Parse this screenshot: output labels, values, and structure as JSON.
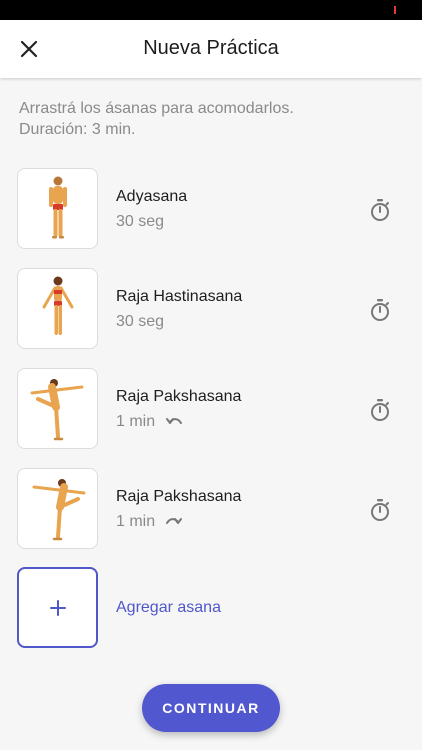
{
  "header": {
    "title": "Nueva Práctica",
    "close_icon": "close-icon"
  },
  "instructions": {
    "line1": "Arrastrá los ásanas para acomodarlos.",
    "line2": "Duración: 3 min."
  },
  "poses": [
    {
      "name": "Adyasana",
      "duration": "30 seg",
      "side_icon": null
    },
    {
      "name": "Raja Hastinasana",
      "duration": "30 seg",
      "side_icon": null
    },
    {
      "name": "Raja Pakshasana",
      "duration": "1 min",
      "side_icon": "undo-arrow-icon"
    },
    {
      "name": "Raja Pakshasana",
      "duration": "1 min",
      "side_icon": "redo-arrow-icon"
    }
  ],
  "add_asana": {
    "label": "Agregar asana",
    "icon": "plus-icon"
  },
  "continue_button": {
    "label": "CONTINUAR"
  },
  "colors": {
    "accent": "#5157cf",
    "skin": "#e8a44e",
    "outfit": "#d83b2c"
  }
}
